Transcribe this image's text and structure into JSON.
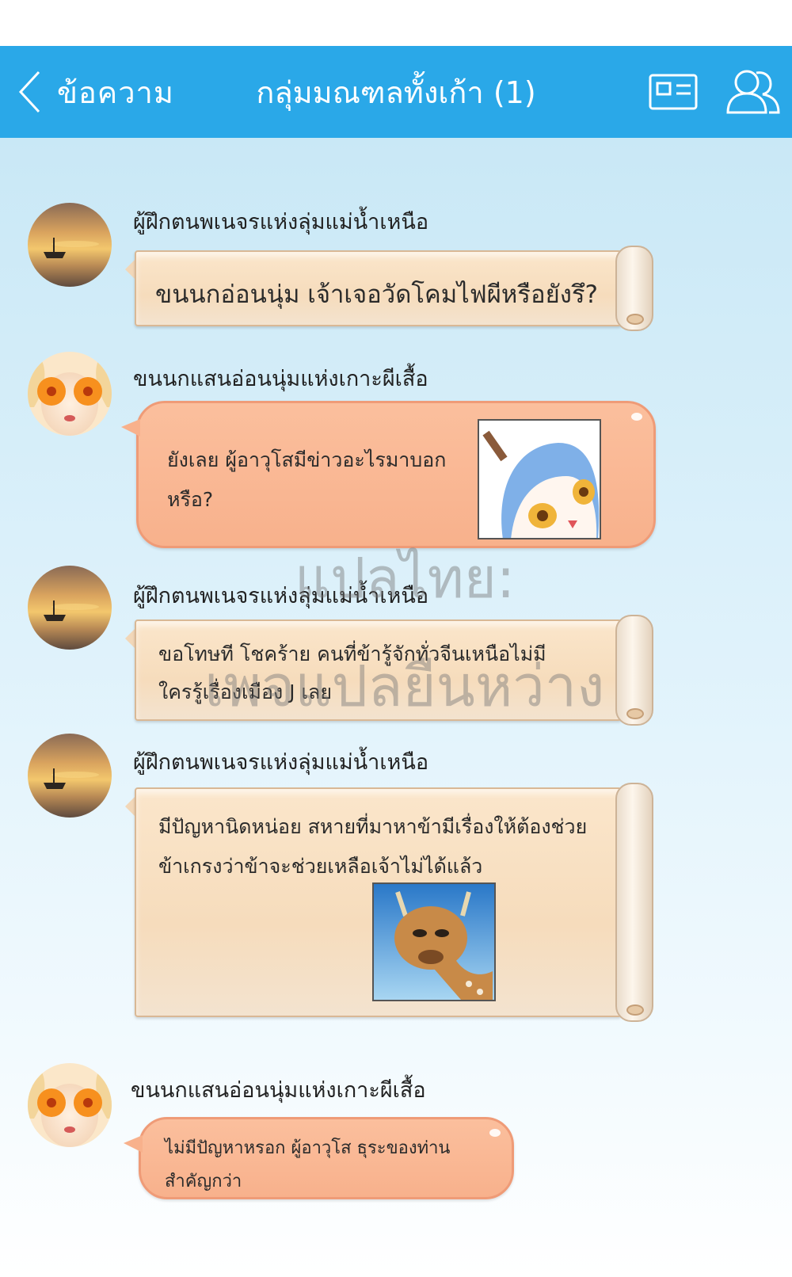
{
  "header": {
    "back_label": "ข้อความ",
    "title": "กลุ่มมณฑลทั้งเก้า (1)"
  },
  "colors": {
    "header_bg": "#2aa8e8",
    "pink_bubble": "#f8b18c",
    "scroll_paper": "#f6dcbc"
  },
  "messages": [
    {
      "sender": "ผู้ฝึกตนพเนจรแห่งลุ่มแม่น้ำเหนือ",
      "avatar": "lake-sunset-avatar",
      "style": "scroll",
      "lines": [
        "ขนนกอ่อนนุ่ม เจ้าเจอวัดโคมไฟผีหรือยังรึ?"
      ]
    },
    {
      "sender": "ขนนกแสนอ่อนนุ่มแห่งเกาะผีเสื้อ",
      "avatar": "flower-eyes-avatar",
      "style": "pink",
      "lines": [
        "ยังเลย ผู้อาวุโสมีข่าวอะไรมาบอก",
        "หรือ?"
      ],
      "sticker": "chibi-girl-sticker"
    },
    {
      "sender": "ผู้ฝึกตนพเนจรแห่งลุ่มแม่น้ำเหนือ",
      "avatar": "lake-sunset-avatar",
      "style": "scroll",
      "lines": [
        "ขอโทษที โชคร้าย คนที่ข้ารู้จักทั่วจีนเหนือไม่มี",
        "ใครรู้เรื่องเมือง J เลย"
      ]
    },
    {
      "sender": "ผู้ฝึกตนพเนจรแห่งลุ่มแม่น้ำเหนือ",
      "avatar": "lake-sunset-avatar",
      "style": "scroll",
      "lines": [
        "มีปัญหานิดหน่อย สหายที่มาหาข้ามีเรื่องให้ต้องช่วย",
        "ข้าเกรงว่าข้าจะช่วยเหลือเจ้าไม่ได้แล้ว"
      ],
      "sticker": "sad-deer-sticker"
    },
    {
      "sender": "ขนนกแสนอ่อนนุ่มแห่งเกาะผีเสื้อ",
      "avatar": "flower-eyes-avatar",
      "style": "pink",
      "lines": [
        "ไม่มีปัญหาหรอก ผู้อาวุโส ธุระของท่าน",
        "สำคัญกว่า"
      ]
    }
  ],
  "watermark": {
    "line1": "แปลไทย:",
    "line2": "เพจแปลยืนหว่าง"
  }
}
